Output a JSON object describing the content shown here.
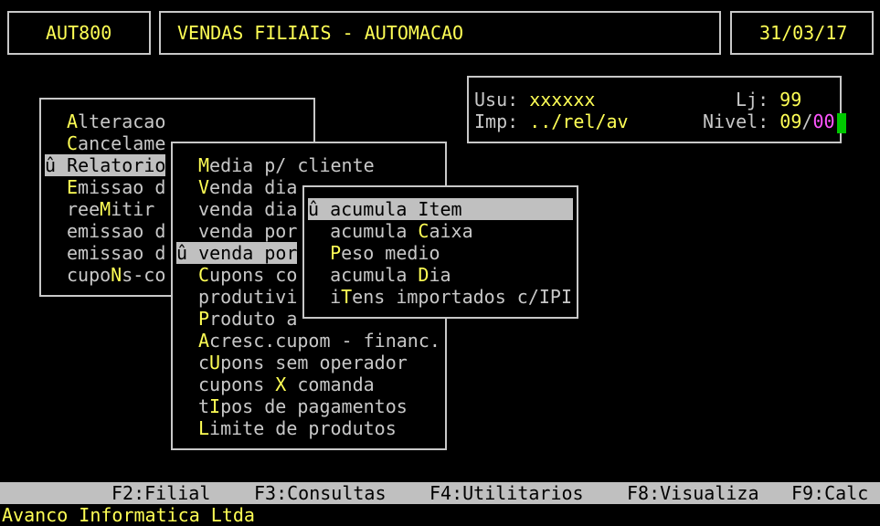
{
  "header": {
    "program": "AUT800",
    "title": "VENDAS FILIAIS - AUTOMACAO",
    "date": "31/03/17"
  },
  "info": {
    "usu_label": "Usu:",
    "usu_value": "xxxxxx",
    "lj_label": "Lj:",
    "lj_value": "99",
    "imp_label": "Imp:",
    "imp_value": "../rel/av",
    "nivel_label": "Nivel:",
    "nivel_a": "09",
    "nivel_sep": "/",
    "nivel_b": "00"
  },
  "menu1": {
    "items": [
      {
        "hot": "A",
        "rest": "lteracao",
        "pre": ""
      },
      {
        "hot": "C",
        "rest": "ancelame",
        "pre": ""
      },
      {
        "hot": "",
        "rest": "Relatorio",
        "pre": "û "
      },
      {
        "hot": "E",
        "rest": "missao d",
        "pre": ""
      },
      {
        "hot": "M",
        "rest": "itir",
        "pre": "ree"
      },
      {
        "hot": "",
        "rest": "emissao d",
        "pre": ""
      },
      {
        "hot": "",
        "rest": "emissao d",
        "pre": ""
      },
      {
        "hot": "N",
        "rest": "s-co",
        "pre": "cupo"
      }
    ]
  },
  "menu2": {
    "items": [
      {
        "pre": "",
        "hot": "M",
        "rest": "edia p/ cliente"
      },
      {
        "pre": "",
        "hot": "V",
        "rest": "enda dia"
      },
      {
        "pre": "",
        "hot": "",
        "rest": "venda dia"
      },
      {
        "pre": "",
        "hot": "",
        "rest": "venda por"
      },
      {
        "pre": "û ",
        "hot": "",
        "rest": "venda por"
      },
      {
        "pre": "",
        "hot": "C",
        "rest": "upons co"
      },
      {
        "pre": "",
        "hot": "",
        "rest": "produtivi"
      },
      {
        "pre": "",
        "hot": "P",
        "rest": "roduto a"
      },
      {
        "pre": "",
        "hot": "A",
        "rest": "cresc.cupom - financ."
      },
      {
        "pre": "c",
        "hot": "U",
        "rest": "pons sem operador"
      },
      {
        "pre": "cupons ",
        "hot": "X",
        "rest": " comanda"
      },
      {
        "pre": "t",
        "hot": "I",
        "rest": "pos de pagamentos"
      },
      {
        "pre": "",
        "hot": "L",
        "rest": "imite de produtos"
      }
    ]
  },
  "menu3": {
    "items": [
      {
        "pre": "û acumula ",
        "hot": "I",
        "rest": "tem"
      },
      {
        "pre": "  acumula ",
        "hot": "C",
        "rest": "aixa"
      },
      {
        "pre": "  ",
        "hot": "P",
        "rest": "eso medio"
      },
      {
        "pre": "  acumula ",
        "hot": "D",
        "rest": "ia"
      },
      {
        "pre": "  i",
        "hot": "T",
        "rest": "ens importados c/IPI"
      }
    ]
  },
  "statusbar": {
    "f2": "F2:Filial",
    "f3": "F3:Consultas",
    "f4": "F4:Utilitarios",
    "f8": "F8:Visualiza",
    "f9": "F9:Calc"
  },
  "footer": "Avanco Informatica Ltda"
}
